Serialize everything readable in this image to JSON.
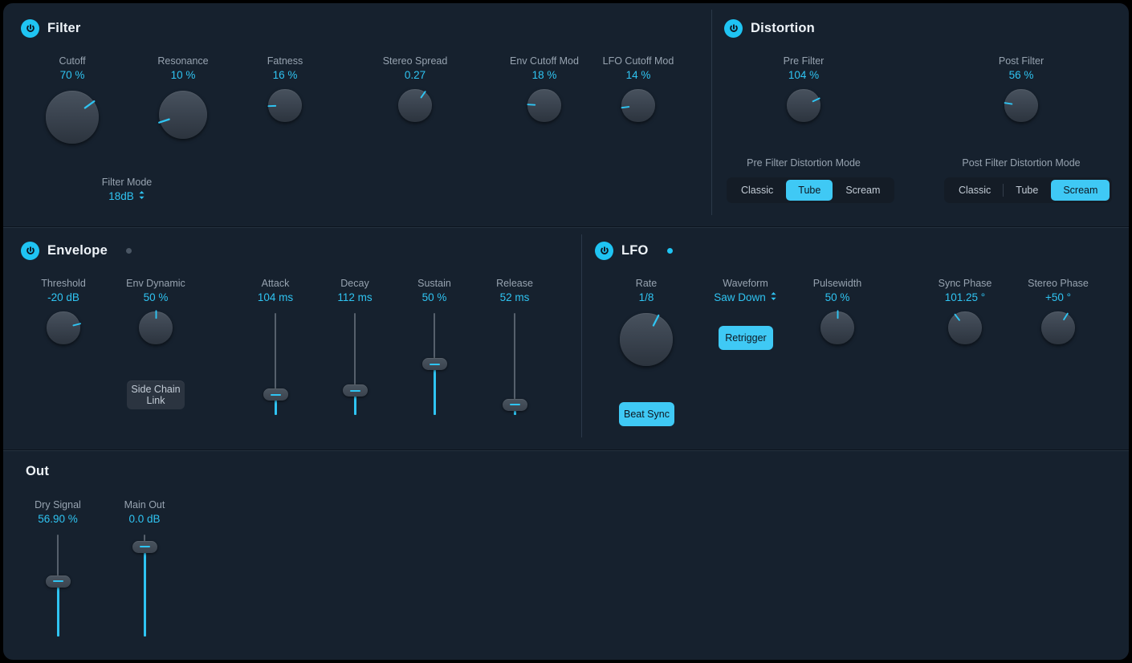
{
  "theme": {
    "accent": "#2fc4f2",
    "accent_bright": "#3fc9f5",
    "background": "#16212e",
    "knob_body": "#3b4450",
    "label": "#97a3b0",
    "title": "#eef3f8"
  },
  "sections": {
    "filter": {
      "title": "Filter",
      "power_icon": "power-icon",
      "enabled": true,
      "controls": [
        {
          "label": "Cutoff",
          "value": "70 %",
          "type": "knob",
          "pct": 70,
          "bipolar": false
        },
        {
          "label": "Resonance",
          "value": "10 %",
          "type": "knob",
          "pct": 10,
          "bipolar": false
        },
        {
          "label": "Fatness",
          "value": "16 %",
          "type": "knob",
          "pct": 16,
          "bipolar": false
        },
        {
          "label": "Stereo Spread",
          "value": "0.27",
          "type": "knob",
          "pct": 63,
          "bipolar": true
        },
        {
          "label": "Env Cutoff Mod",
          "value": "18 %",
          "type": "knob",
          "pct": 18,
          "bipolar": false
        },
        {
          "label": "LFO Cutoff Mod",
          "value": "14 %",
          "type": "knob",
          "pct": 14,
          "bipolar": false
        }
      ],
      "filter_mode": {
        "label": "Filter Mode",
        "value": "18dB",
        "icon": "chevron-updown-icon"
      }
    },
    "distortion": {
      "title": "Distortion",
      "power_icon": "power-icon",
      "enabled": true,
      "controls": [
        {
          "label": "Pre Filter",
          "value": "104 %",
          "type": "knob",
          "pct": 74,
          "bipolar": false
        },
        {
          "label": "Post Filter",
          "value": "56 %",
          "type": "knob",
          "pct": 20,
          "bipolar": false
        }
      ],
      "pre_mode": {
        "label": "Pre Filter Distortion Mode",
        "options": [
          "Classic",
          "Tube",
          "Scream"
        ],
        "selected": "Tube"
      },
      "post_mode": {
        "label": "Post Filter Distortion Mode",
        "options": [
          "Classic",
          "Tube",
          "Scream"
        ],
        "selected": "Scream"
      }
    },
    "envelope": {
      "title": "Envelope",
      "power_icon": "power-icon",
      "enabled": true,
      "activity_dot": false,
      "knobs": [
        {
          "label": "Threshold",
          "value": "-20 dB",
          "pct": 78,
          "bipolar": false
        },
        {
          "label": "Env Dynamic",
          "value": "50 %",
          "pct": 50,
          "bipolar": false
        }
      ],
      "side_chain": {
        "line1": "Side Chain",
        "line2": "Link",
        "active": false
      },
      "sliders": [
        {
          "label": "Attack",
          "value": "104 ms",
          "pos": 0.8
        },
        {
          "label": "Decay",
          "value": "112 ms",
          "pos": 0.76
        },
        {
          "label": "Sustain",
          "value": "50 %",
          "pos": 0.5
        },
        {
          "label": "Release",
          "value": "52 ms",
          "pos": 0.9
        }
      ]
    },
    "lfo": {
      "title": "LFO",
      "power_icon": "power-icon",
      "enabled": true,
      "activity_dot": true,
      "rate": {
        "label": "Rate",
        "value": "1/8",
        "pct": 60,
        "bipolar": false
      },
      "beat_sync": {
        "label": "Beat Sync",
        "active": true
      },
      "waveform": {
        "label": "Waveform",
        "value": "Saw Down",
        "icon": "chevron-updown-icon"
      },
      "retrigger": {
        "label": "Retrigger",
        "active": true
      },
      "knobs": [
        {
          "label": "Pulsewidth",
          "value": "50 %",
          "pct": 50,
          "bipolar": false
        },
        {
          "label": "Sync Phase",
          "value": "101.25 °",
          "pct": 36,
          "bipolar": true
        },
        {
          "label": "Stereo Phase",
          "value": "+50 °",
          "pct": 62,
          "bipolar": true
        }
      ]
    },
    "out": {
      "title": "Out",
      "sliders": [
        {
          "label": "Dry Signal",
          "value": "56.90 %",
          "pos": 0.46
        },
        {
          "label": "Main Out",
          "value": "0.0 dB",
          "pos": 0.12
        }
      ]
    }
  }
}
